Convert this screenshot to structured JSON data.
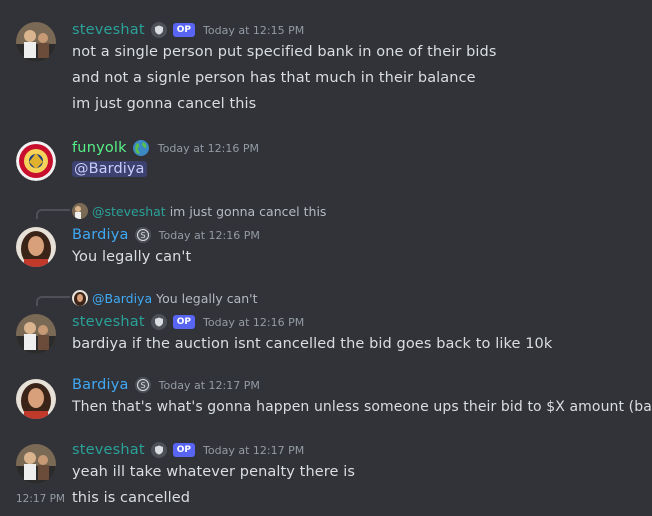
{
  "colors": {
    "background": "#313338",
    "steveshat": "#2aa198",
    "funyolk": "#57f287",
    "bardiya": "#3fa9f5",
    "op_badge": "#5865f2"
  },
  "messages": [
    {
      "user": "steveshat",
      "timestamp": "Today at 12:15 PM",
      "badges": [
        "shield-icon",
        "OP"
      ],
      "lines": [
        "not a single person put specified bank in one of their bids",
        "and not a signle person has that much in their balance",
        "im just gonna cancel this"
      ]
    },
    {
      "user": "funyolk",
      "timestamp": "Today at 12:16 PM",
      "badges": [
        "globe-icon"
      ],
      "mention": "@Bardiya"
    },
    {
      "reply_to": {
        "user": "@steveshat",
        "text": "im just gonna cancel this"
      },
      "user": "Bardiya",
      "timestamp": "Today at 12:16 PM",
      "badges": [
        "nitro-s-icon"
      ],
      "lines": [
        "You legally can't"
      ]
    },
    {
      "reply_to": {
        "user": "@Bardiya",
        "text": "You legally can't"
      },
      "user": "steveshat",
      "timestamp": "Today at 12:16 PM",
      "badges": [
        "shield-icon",
        "OP"
      ],
      "lines": [
        "bardiya if the auction isnt cancelled the bid goes back to like 10k"
      ]
    },
    {
      "user": "Bardiya",
      "timestamp": "Today at 12:17 PM",
      "badges": [
        "nitro-s-icon"
      ],
      "lines": [
        "Then that's what's gonna happen unless someone ups their bid to $X amount (bank)"
      ]
    },
    {
      "user": "steveshat",
      "timestamp": "Today at 12:17 PM",
      "badges": [
        "shield-icon",
        "OP"
      ],
      "lines": [
        "yeah ill take whatever penalty there is",
        "this is cancelled"
      ],
      "side_timestamp": "12:17 PM"
    }
  ]
}
